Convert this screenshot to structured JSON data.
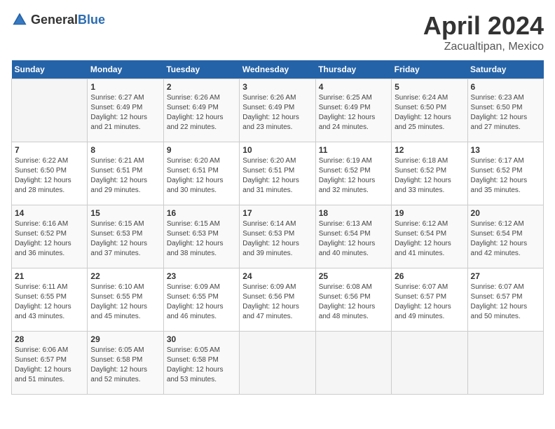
{
  "header": {
    "logo_general": "General",
    "logo_blue": "Blue",
    "month_title": "April 2024",
    "location": "Zacualtipan, Mexico"
  },
  "weekdays": [
    "Sunday",
    "Monday",
    "Tuesday",
    "Wednesday",
    "Thursday",
    "Friday",
    "Saturday"
  ],
  "weeks": [
    [
      {
        "day": "",
        "sunrise": "",
        "sunset": "",
        "daylight": ""
      },
      {
        "day": "1",
        "sunrise": "Sunrise: 6:27 AM",
        "sunset": "Sunset: 6:49 PM",
        "daylight": "Daylight: 12 hours and 21 minutes."
      },
      {
        "day": "2",
        "sunrise": "Sunrise: 6:26 AM",
        "sunset": "Sunset: 6:49 PM",
        "daylight": "Daylight: 12 hours and 22 minutes."
      },
      {
        "day": "3",
        "sunrise": "Sunrise: 6:26 AM",
        "sunset": "Sunset: 6:49 PM",
        "daylight": "Daylight: 12 hours and 23 minutes."
      },
      {
        "day": "4",
        "sunrise": "Sunrise: 6:25 AM",
        "sunset": "Sunset: 6:49 PM",
        "daylight": "Daylight: 12 hours and 24 minutes."
      },
      {
        "day": "5",
        "sunrise": "Sunrise: 6:24 AM",
        "sunset": "Sunset: 6:50 PM",
        "daylight": "Daylight: 12 hours and 25 minutes."
      },
      {
        "day": "6",
        "sunrise": "Sunrise: 6:23 AM",
        "sunset": "Sunset: 6:50 PM",
        "daylight": "Daylight: 12 hours and 27 minutes."
      }
    ],
    [
      {
        "day": "7",
        "sunrise": "Sunrise: 6:22 AM",
        "sunset": "Sunset: 6:50 PM",
        "daylight": "Daylight: 12 hours and 28 minutes."
      },
      {
        "day": "8",
        "sunrise": "Sunrise: 6:21 AM",
        "sunset": "Sunset: 6:51 PM",
        "daylight": "Daylight: 12 hours and 29 minutes."
      },
      {
        "day": "9",
        "sunrise": "Sunrise: 6:20 AM",
        "sunset": "Sunset: 6:51 PM",
        "daylight": "Daylight: 12 hours and 30 minutes."
      },
      {
        "day": "10",
        "sunrise": "Sunrise: 6:20 AM",
        "sunset": "Sunset: 6:51 PM",
        "daylight": "Daylight: 12 hours and 31 minutes."
      },
      {
        "day": "11",
        "sunrise": "Sunrise: 6:19 AM",
        "sunset": "Sunset: 6:52 PM",
        "daylight": "Daylight: 12 hours and 32 minutes."
      },
      {
        "day": "12",
        "sunrise": "Sunrise: 6:18 AM",
        "sunset": "Sunset: 6:52 PM",
        "daylight": "Daylight: 12 hours and 33 minutes."
      },
      {
        "day": "13",
        "sunrise": "Sunrise: 6:17 AM",
        "sunset": "Sunset: 6:52 PM",
        "daylight": "Daylight: 12 hours and 35 minutes."
      }
    ],
    [
      {
        "day": "14",
        "sunrise": "Sunrise: 6:16 AM",
        "sunset": "Sunset: 6:52 PM",
        "daylight": "Daylight: 12 hours and 36 minutes."
      },
      {
        "day": "15",
        "sunrise": "Sunrise: 6:15 AM",
        "sunset": "Sunset: 6:53 PM",
        "daylight": "Daylight: 12 hours and 37 minutes."
      },
      {
        "day": "16",
        "sunrise": "Sunrise: 6:15 AM",
        "sunset": "Sunset: 6:53 PM",
        "daylight": "Daylight: 12 hours and 38 minutes."
      },
      {
        "day": "17",
        "sunrise": "Sunrise: 6:14 AM",
        "sunset": "Sunset: 6:53 PM",
        "daylight": "Daylight: 12 hours and 39 minutes."
      },
      {
        "day": "18",
        "sunrise": "Sunrise: 6:13 AM",
        "sunset": "Sunset: 6:54 PM",
        "daylight": "Daylight: 12 hours and 40 minutes."
      },
      {
        "day": "19",
        "sunrise": "Sunrise: 6:12 AM",
        "sunset": "Sunset: 6:54 PM",
        "daylight": "Daylight: 12 hours and 41 minutes."
      },
      {
        "day": "20",
        "sunrise": "Sunrise: 6:12 AM",
        "sunset": "Sunset: 6:54 PM",
        "daylight": "Daylight: 12 hours and 42 minutes."
      }
    ],
    [
      {
        "day": "21",
        "sunrise": "Sunrise: 6:11 AM",
        "sunset": "Sunset: 6:55 PM",
        "daylight": "Daylight: 12 hours and 43 minutes."
      },
      {
        "day": "22",
        "sunrise": "Sunrise: 6:10 AM",
        "sunset": "Sunset: 6:55 PM",
        "daylight": "Daylight: 12 hours and 45 minutes."
      },
      {
        "day": "23",
        "sunrise": "Sunrise: 6:09 AM",
        "sunset": "Sunset: 6:55 PM",
        "daylight": "Daylight: 12 hours and 46 minutes."
      },
      {
        "day": "24",
        "sunrise": "Sunrise: 6:09 AM",
        "sunset": "Sunset: 6:56 PM",
        "daylight": "Daylight: 12 hours and 47 minutes."
      },
      {
        "day": "25",
        "sunrise": "Sunrise: 6:08 AM",
        "sunset": "Sunset: 6:56 PM",
        "daylight": "Daylight: 12 hours and 48 minutes."
      },
      {
        "day": "26",
        "sunrise": "Sunrise: 6:07 AM",
        "sunset": "Sunset: 6:57 PM",
        "daylight": "Daylight: 12 hours and 49 minutes."
      },
      {
        "day": "27",
        "sunrise": "Sunrise: 6:07 AM",
        "sunset": "Sunset: 6:57 PM",
        "daylight": "Daylight: 12 hours and 50 minutes."
      }
    ],
    [
      {
        "day": "28",
        "sunrise": "Sunrise: 6:06 AM",
        "sunset": "Sunset: 6:57 PM",
        "daylight": "Daylight: 12 hours and 51 minutes."
      },
      {
        "day": "29",
        "sunrise": "Sunrise: 6:05 AM",
        "sunset": "Sunset: 6:58 PM",
        "daylight": "Daylight: 12 hours and 52 minutes."
      },
      {
        "day": "30",
        "sunrise": "Sunrise: 6:05 AM",
        "sunset": "Sunset: 6:58 PM",
        "daylight": "Daylight: 12 hours and 53 minutes."
      },
      {
        "day": "",
        "sunrise": "",
        "sunset": "",
        "daylight": ""
      },
      {
        "day": "",
        "sunrise": "",
        "sunset": "",
        "daylight": ""
      },
      {
        "day": "",
        "sunrise": "",
        "sunset": "",
        "daylight": ""
      },
      {
        "day": "",
        "sunrise": "",
        "sunset": "",
        "daylight": ""
      }
    ]
  ]
}
